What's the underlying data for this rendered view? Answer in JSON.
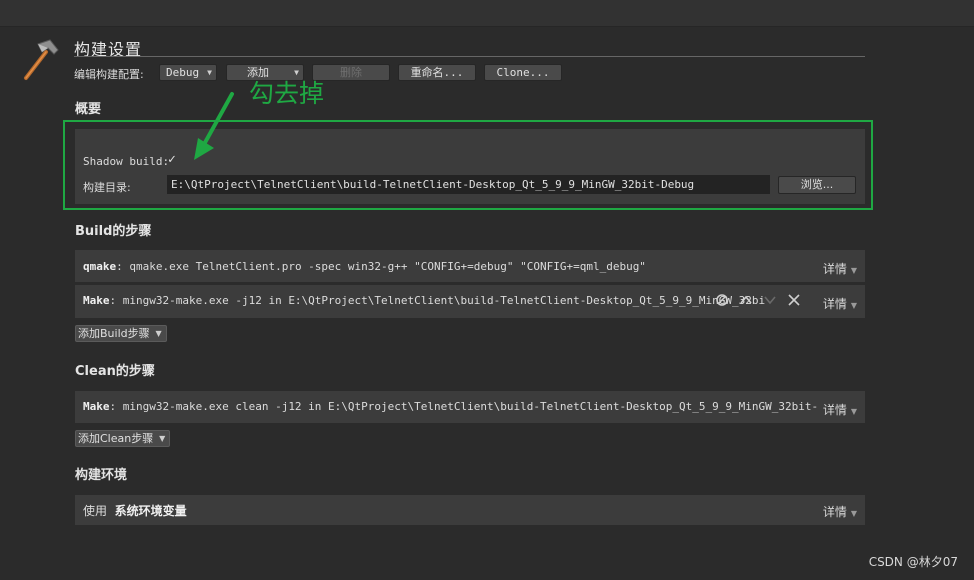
{
  "header": {
    "title": "构建设置"
  },
  "edit_config": {
    "label": "编辑构建配置:",
    "config_value": "Debug",
    "add_label": "添加",
    "delete_label": "删除",
    "rename_label": "重命名...",
    "clone_label": "Clone..."
  },
  "overview": {
    "heading": "概要",
    "shadow_build_label": "Shadow build:",
    "shadow_build_checked": "✓",
    "build_dir_label": "构建目录:",
    "build_dir_value": "E:\\QtProject\\TelnetClient\\build-TelnetClient-Desktop_Qt_5_9_9_MinGW_32bit-Debug",
    "browse_label": "浏览..."
  },
  "annotation": {
    "text": "勾去掉",
    "color": "#1fa843"
  },
  "build_steps": {
    "heading": "Build的步骤",
    "steps": [
      {
        "name": "qmake",
        "command": "qmake.exe TelnetClient.pro -spec win32-g++ \"CONFIG+=debug\" \"CONFIG+=qml_debug\"",
        "details": "详情"
      },
      {
        "name": "Make",
        "command": "mingw32-make.exe -j12 in E:\\QtProject\\TelnetClient\\build-TelnetClient-Desktop_Qt_5_9_9_MinGW_32bi",
        "details": "详情"
      }
    ],
    "add_label": "添加Build步骤"
  },
  "clean_steps": {
    "heading": "Clean的步骤",
    "steps": [
      {
        "name": "Make",
        "command": "mingw32-make.exe clean -j12 in E:\\QtProject\\TelnetClient\\build-TelnetClient-Desktop_Qt_5_9_9_MinGW_32bit-",
        "details": "详情"
      }
    ],
    "add_label": "添加Clean步骤"
  },
  "environment": {
    "heading": "构建环境",
    "use_label": "使用",
    "env_name": "系统环境变量",
    "details": "详情"
  },
  "watermark": "CSDN @林夕07"
}
